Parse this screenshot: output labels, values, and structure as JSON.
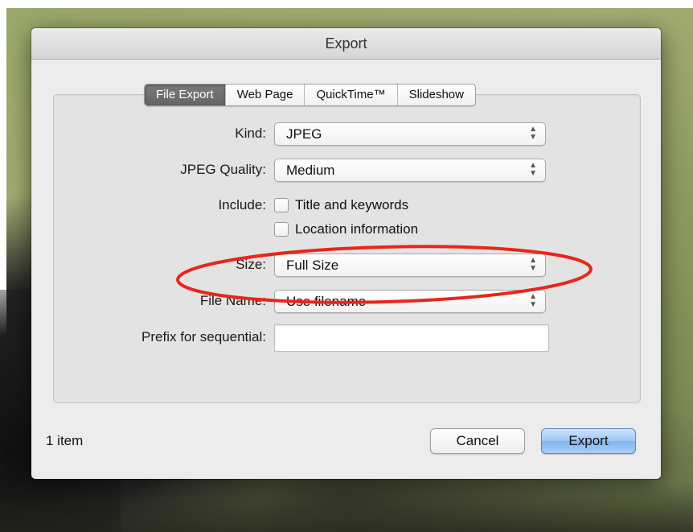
{
  "dialog": {
    "title": "Export",
    "tabs": [
      {
        "label": "File Export",
        "active": true
      },
      {
        "label": "Web Page",
        "active": false
      },
      {
        "label": "QuickTime™",
        "active": false
      },
      {
        "label": "Slideshow",
        "active": false
      }
    ],
    "form": {
      "kind": {
        "label": "Kind:",
        "value": "JPEG"
      },
      "jpeg_quality": {
        "label": "JPEG Quality:",
        "value": "Medium"
      },
      "include": {
        "label": "Include:",
        "title_keywords": {
          "label": "Title and keywords",
          "checked": false
        },
        "location_info": {
          "label": "Location information",
          "checked": false
        }
      },
      "size": {
        "label": "Size:",
        "value": "Full Size"
      },
      "file_name": {
        "label": "File Name:",
        "value": "Use filename"
      },
      "prefix": {
        "label": "Prefix for sequential:",
        "value": ""
      }
    },
    "footer": {
      "item_count": "1 item",
      "cancel_label": "Cancel",
      "export_label": "Export"
    },
    "icons": {
      "popup_arrows": "updown-chevron-icon"
    }
  },
  "annotation": {
    "color": "#e8261c",
    "shape": "ellipse",
    "encircles": "size"
  },
  "colors": {
    "default_button": "#8fbdf3",
    "active_tab": "#6e6e6e"
  }
}
